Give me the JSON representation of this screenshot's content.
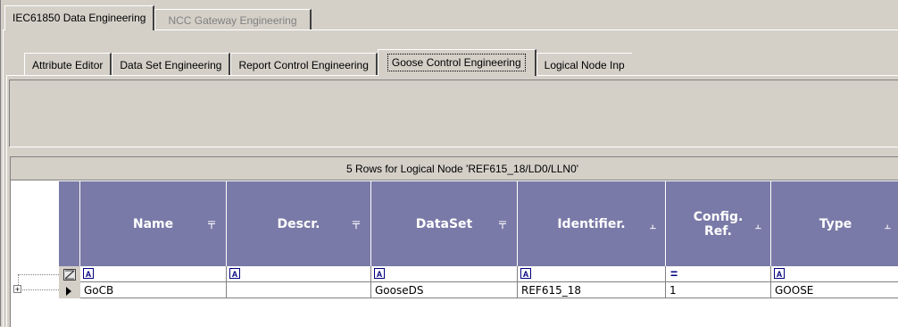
{
  "tabs_top": {
    "iec": "IEC61850 Data Engineering",
    "ncc": "NCC Gateway Engineering"
  },
  "tabs_sub": {
    "attribute_editor": "Attribute Editor",
    "data_set": "Data Set Engineering",
    "report_control": "Report Control Engineering",
    "goose_control": "Goose Control Engineering",
    "logical_node": "Logical Node Inp"
  },
  "grid": {
    "caption": "5 Rows for Logical Node 'REF615_18/LD0/LLN0'",
    "columns": [
      "Name",
      "Descr.",
      "DataSet",
      "Identifier.",
      "Config. Ref.",
      "Type"
    ],
    "pin_glyphs": [
      "〒",
      "〒",
      "〒",
      "⫠",
      "⫠",
      "⫠"
    ],
    "filter_icons": [
      "A",
      "A",
      "A",
      "A",
      "=",
      "A"
    ],
    "rows": [
      [
        "GoCB",
        "",
        "GooseDS",
        "REF615_18",
        "1",
        "GOOSE"
      ]
    ]
  },
  "colors": {
    "header_bg": "#7a7aa8",
    "face": "#d4d0c8"
  }
}
